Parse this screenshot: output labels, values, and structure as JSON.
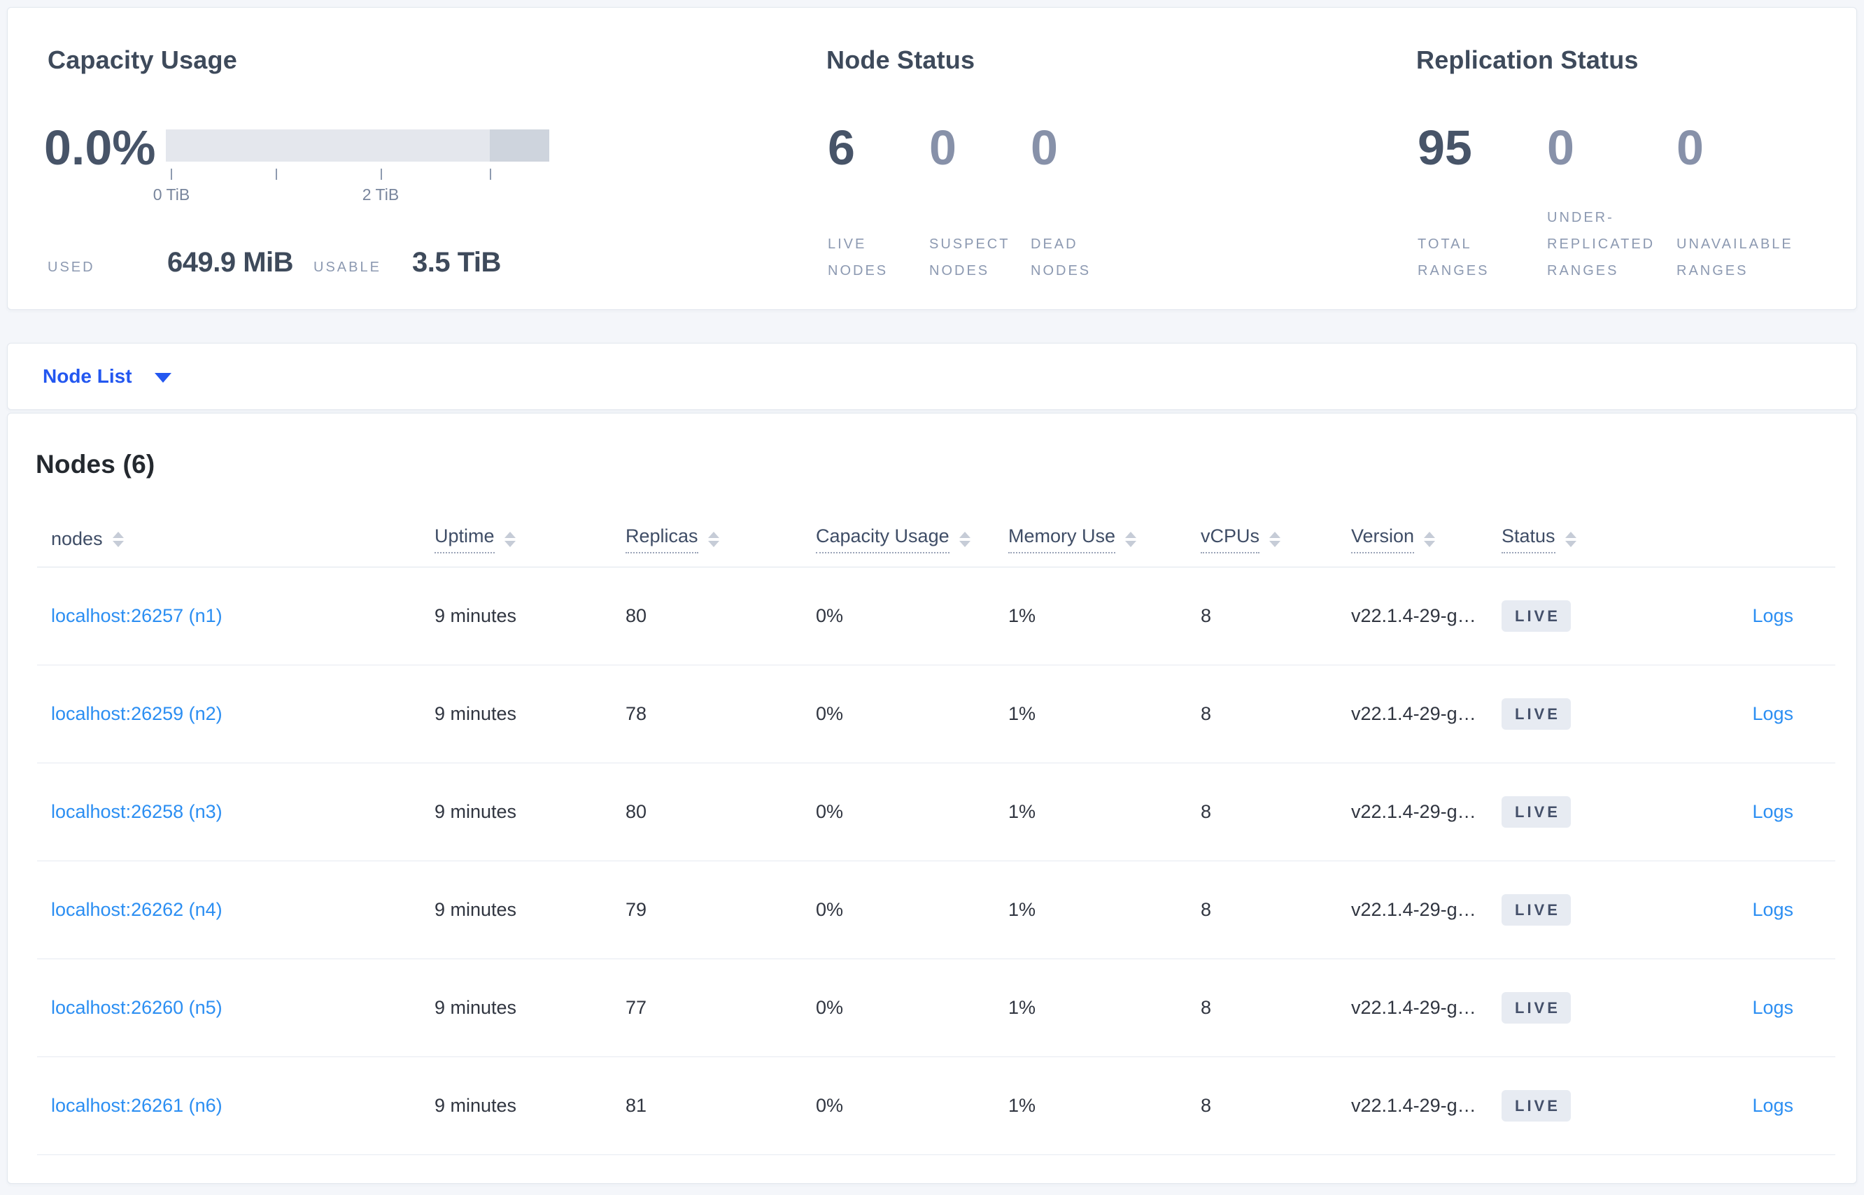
{
  "summary": {
    "capacity": {
      "title": "Capacity Usage",
      "percent": "0.0%",
      "axis_ticks": [
        "0 TiB",
        "2 TiB"
      ],
      "used_label": "USED",
      "used_value": "649.9 MiB",
      "usable_label": "USABLE",
      "usable_value": "3.5 TiB",
      "bar_segment_start_pct": 84.5
    },
    "node_status": {
      "title": "Node Status",
      "stats": [
        {
          "value": "6",
          "lines": [
            "LIVE",
            "NODES"
          ]
        },
        {
          "value": "0",
          "lines": [
            "SUSPECT",
            "NODES"
          ]
        },
        {
          "value": "0",
          "lines": [
            "DEAD",
            "NODES"
          ]
        }
      ]
    },
    "replication": {
      "title": "Replication Status",
      "stats": [
        {
          "value": "95",
          "lines": [
            "TOTAL",
            "RANGES"
          ]
        },
        {
          "value": "0",
          "lines": [
            "UNDER-",
            "REPLICATED",
            "RANGES"
          ]
        },
        {
          "value": "0",
          "lines": [
            "UNAVAILABLE",
            "RANGES"
          ]
        }
      ]
    }
  },
  "node_list_dropdown": {
    "label": "Node List"
  },
  "nodes_table": {
    "title": "Nodes (6)",
    "columns": {
      "nodes": "nodes",
      "uptime": "Uptime",
      "replicas": "Replicas",
      "capacity": "Capacity Usage",
      "memory": "Memory Use",
      "vcpus": "vCPUs",
      "version": "Version",
      "status": "Status"
    },
    "rows": [
      {
        "node": "localhost:26257 (n1)",
        "uptime": "9 minutes",
        "replicas": "80",
        "capacity": "0%",
        "memory": "1%",
        "vcpus": "8",
        "version": "v22.1.4-29-g…",
        "status": "LIVE",
        "logs": "Logs"
      },
      {
        "node": "localhost:26259 (n2)",
        "uptime": "9 minutes",
        "replicas": "78",
        "capacity": "0%",
        "memory": "1%",
        "vcpus": "8",
        "version": "v22.1.4-29-g…",
        "status": "LIVE",
        "logs": "Logs"
      },
      {
        "node": "localhost:26258 (n3)",
        "uptime": "9 minutes",
        "replicas": "80",
        "capacity": "0%",
        "memory": "1%",
        "vcpus": "8",
        "version": "v22.1.4-29-g…",
        "status": "LIVE",
        "logs": "Logs"
      },
      {
        "node": "localhost:26262 (n4)",
        "uptime": "9 minutes",
        "replicas": "79",
        "capacity": "0%",
        "memory": "1%",
        "vcpus": "8",
        "version": "v22.1.4-29-g…",
        "status": "LIVE",
        "logs": "Logs"
      },
      {
        "node": "localhost:26260 (n5)",
        "uptime": "9 minutes",
        "replicas": "77",
        "capacity": "0%",
        "memory": "1%",
        "vcpus": "8",
        "version": "v22.1.4-29-g…",
        "status": "LIVE",
        "logs": "Logs"
      },
      {
        "node": "localhost:26261 (n6)",
        "uptime": "9 minutes",
        "replicas": "81",
        "capacity": "0%",
        "memory": "1%",
        "vcpus": "8",
        "version": "v22.1.4-29-g…",
        "status": "LIVE",
        "logs": "Logs"
      }
    ]
  },
  "colors": {
    "page_background": "#f4f6fa",
    "heading_text": "#3e4a5b",
    "big_number": "#475468",
    "big_number_dim": "#8791a9",
    "muted_label": "#8c99b1",
    "link_blue": "#2b8ef2",
    "dropdown_blue": "#2357f0",
    "badge_background": "#e7ebf2",
    "badge_text": "#44506a",
    "bar_track": "#e4e7ed",
    "bar_segment": "#ced4dd",
    "row_divider": "#e6eaf1"
  }
}
